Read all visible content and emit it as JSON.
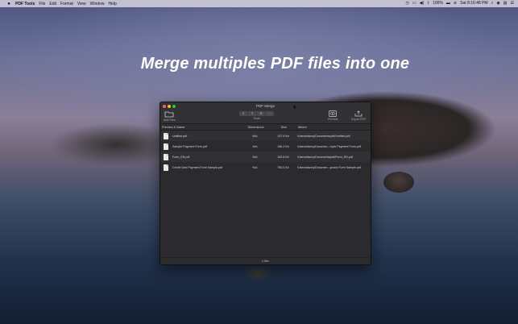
{
  "menubar": {
    "apple": "",
    "app_name": "PDF Tools",
    "items": [
      "File",
      "Edit",
      "Format",
      "View",
      "Window",
      "Help"
    ],
    "battery": "100%",
    "clock": "Sat 8:16:48 PM"
  },
  "headline": "Merge multiples PDF files into one",
  "window": {
    "title": "PDF Merge",
    "toolbar": {
      "add_files": "Add Files",
      "tools": "Tools",
      "tool_buttons": [
        "⇩",
        "⇧",
        "✕",
        "⋯"
      ],
      "preview": "Preview",
      "export": "Export PDF"
    },
    "columns": {
      "name": "Preview & Name",
      "dimensions": "Dimensions",
      "size": "Size",
      "where": "Where"
    },
    "files": [
      {
        "name": "Untitled.pdf",
        "dimensions": "N/A",
        "size": "137.5 Kb",
        "where": "/Users/danny/Documents/pdf/Untitled.pdf"
      },
      {
        "name": "Sample Payment Form.pdf",
        "dimensions": "N/A",
        "size": "166.4 Kb",
        "where": "/Users/danny/Documen...mple Payment Form.pdf"
      },
      {
        "name": "Form_EN.pdf",
        "dimensions": "N/A",
        "size": "153.6 Kb",
        "where": "/Users/danny/Documents/pdf/Form_EN.pdf"
      },
      {
        "name": "Credit Card Payment Form Sample.pdf",
        "dimensions": "N/A",
        "size": "790.5 Kb",
        "where": "/Users/danny/Documen...yment Form Sample.pdf"
      }
    ],
    "footer": "4 files"
  },
  "colors": {
    "close": "#ff5f57",
    "minimize": "#febc2e",
    "zoom": "#28c840"
  }
}
